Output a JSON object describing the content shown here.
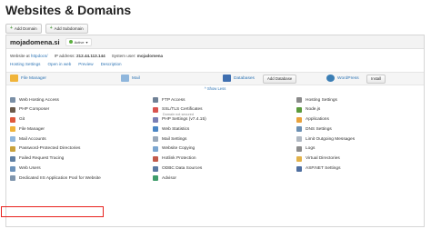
{
  "page_title": "Websites & Domains",
  "top_actions": [
    {
      "label": "Add Domain"
    },
    {
      "label": "Add Subdomain"
    }
  ],
  "domain": {
    "name": "mojadomena.si",
    "status": "Active",
    "website_at_label": "Website at",
    "website_at_link": "httpdocs/",
    "ip_label": "IP address:",
    "ip_value": "212.44.113.144",
    "user_label": "System user:",
    "user_value": "mojadomena",
    "links": [
      "Hosting Settings",
      "Open in web",
      "Preview",
      "Description"
    ]
  },
  "quick": {
    "file_manager": "File Manager",
    "mail": "Mail",
    "databases": "Databases",
    "add_database": "Add Database",
    "wordpress": "WordPress",
    "install": "Install"
  },
  "show_less": "^ Show Less",
  "tools": [
    [
      "Web Hosting Access",
      "FTP Access",
      "Hosting Settings"
    ],
    [
      "PHP Composer",
      "SSL/TLS Certificates",
      "Node.js"
    ],
    [
      "Git",
      "PHP Settings (v7.4.15)",
      "Applications"
    ],
    [
      "File Manager",
      "Web Statistics",
      "DNS Settings"
    ],
    [
      "Mail Accounts",
      "Mail Settings",
      "Limit Outgoing Messages"
    ],
    [
      "Password-Protected Directories",
      "Website Copying",
      "Logs"
    ],
    [
      "Failed Request Tracing",
      "Hotlink Protection",
      "Virtual Directories"
    ],
    [
      "Web Users",
      "ODBC Data Sources",
      "ASP.NET Settings"
    ],
    [
      "Dedicated IIS Application Pool for Website",
      "Advisor",
      ""
    ]
  ],
  "ssl_sub": "Domain not secured",
  "tool_icon_names": [
    [
      "globe-icon",
      "ftp-icon",
      "gear-icon"
    ],
    [
      "composer-icon",
      "certificate-icon",
      "nodejs-icon"
    ],
    [
      "git-icon",
      "php-icon",
      "apps-icon"
    ],
    [
      "folder-icon",
      "stats-icon",
      "dns-icon"
    ],
    [
      "mail-icon",
      "mail-settings-icon",
      "limit-icon"
    ],
    [
      "lock-icon",
      "copy-icon",
      "logs-icon"
    ],
    [
      "tracing-icon",
      "hotlink-icon",
      "directory-icon"
    ],
    [
      "users-icon",
      "odbc-icon",
      "aspnet-icon"
    ],
    [
      "pool-icon",
      "advisor-icon",
      ""
    ]
  ],
  "colors": {
    "link": "#2f75b5",
    "active": "#5cae3f",
    "highlight": "#e8211d"
  }
}
